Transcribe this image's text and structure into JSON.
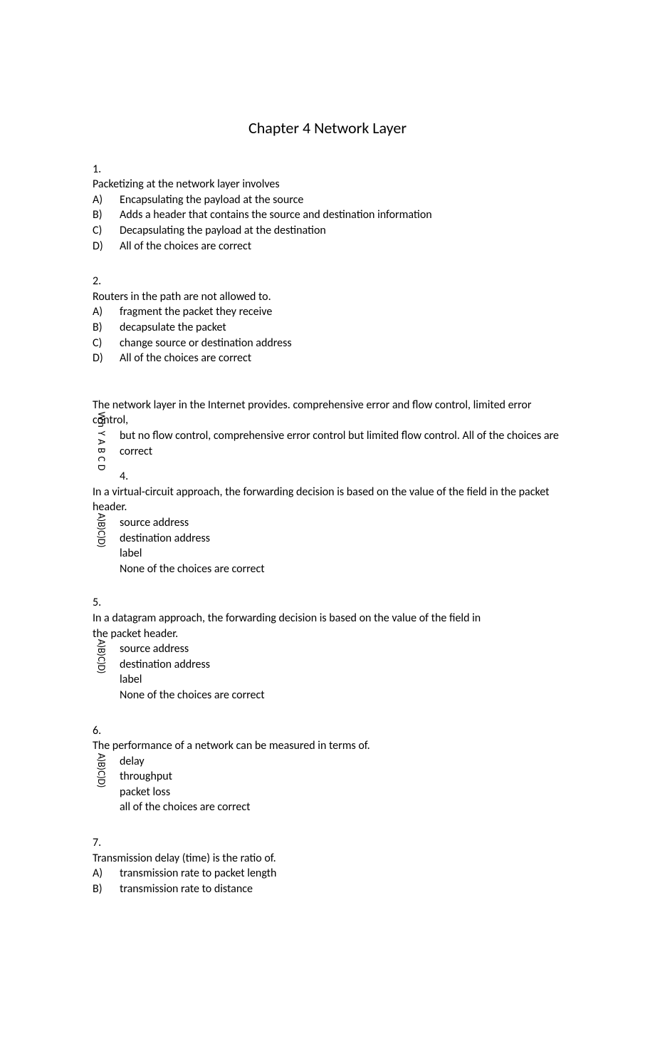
{
  "title": "Chapter 4 Network Layer",
  "q1": {
    "num": "1.",
    "text": "Packetizing at the network layer involves",
    "opts": {
      "A": "Encapsulating the payload at the source",
      "B": "Adds a header that contains the source and destination information",
      "C": "Decapsulating the payload at the destination",
      "D": "All of the choices are correct"
    },
    "letters": {
      "A": "A)",
      "B": "B)",
      "C": "C)",
      "D": "D)"
    }
  },
  "q2": {
    "num": "2.",
    "text": "Routers in the path are not allowed to.",
    "opts": {
      "A": "fragment the packet they receive",
      "B": "decapsulate the packet",
      "C": "change source or destination address",
      "D": "All of the choices are correct"
    },
    "letters": {
      "A": "A)",
      "B": "B)",
      "C": "C)",
      "D": "D)"
    }
  },
  "q3": {
    "line1": "The network layer in the Internet provides. comprehensive error and flow control, limited error control,",
    "line2": "but no flow control, comprehensive error control but limited flow control. All of the choices are correct",
    "vlabels": [
      "W",
      "h",
      "Y",
      "A",
      "B",
      "C",
      "D"
    ]
  },
  "q4": {
    "num": "4.",
    "text": "In a virtual-circuit approach, the forwarding decision is based on the value of the field in the packet header.",
    "opts": {
      "A": "source address",
      "B": "destination address",
      "C": "label",
      "D": "None of the choices are correct"
    },
    "vlabels": [
      "A)",
      "B)",
      "C)",
      "D)"
    ]
  },
  "q5": {
    "num": "5.",
    "line1": "In a datagram approach, the forwarding decision is based on the value of the field in",
    "line2": "the packet header.",
    "opts": {
      "A": "source address",
      "B": "destination address",
      "C": "label",
      "D": "None of the choices are correct"
    },
    "vlabels": [
      "A)",
      "B)",
      "C)",
      "D)"
    ]
  },
  "q6": {
    "num": "6.",
    "text": "The performance of a network can be measured in terms of.",
    "opts": {
      "A": "delay",
      "B": "throughput",
      "C": "packet loss",
      "D": "all of the choices are correct"
    },
    "vlabels": [
      "A)",
      "B)",
      "C)",
      "D)"
    ]
  },
  "q7": {
    "num": "7.",
    "text": "Transmission delay (time) is the ratio of.",
    "opts": {
      "A": "transmission rate to packet length",
      "B": "transmission rate to distance"
    },
    "letters": {
      "A": "A)",
      "B": "B)"
    }
  }
}
